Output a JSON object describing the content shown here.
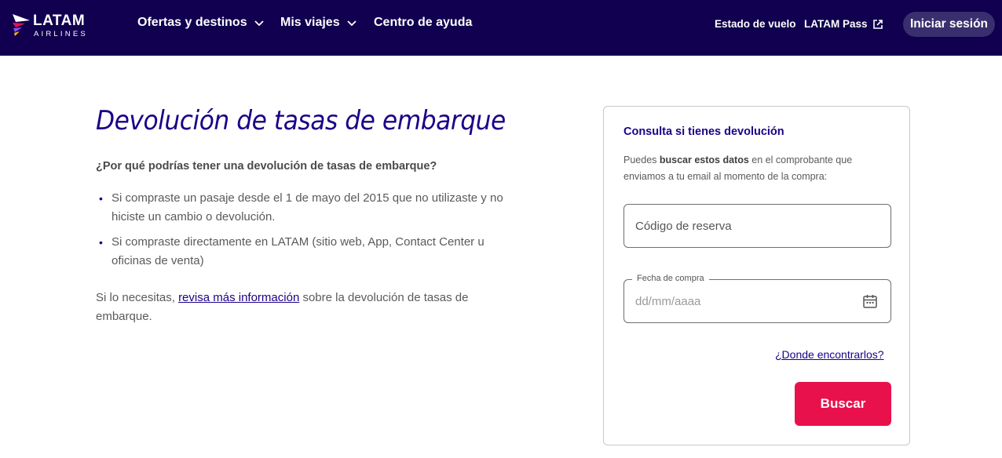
{
  "header": {
    "logo_word": "LATAM",
    "logo_sub": "AIRLINES",
    "nav": [
      {
        "label": "Ofertas y destinos"
      },
      {
        "label": "Mis viajes"
      },
      {
        "label": "Centro de ayuda"
      }
    ],
    "flight_status": "Estado de vuelo",
    "latam_pass": "LATAM Pass",
    "login": "Iniciar sesión"
  },
  "content": {
    "title": "Devolución de tasas de embarque",
    "question": "¿Por qué podrías tener una devolución de tasas de embarque?",
    "bullets": [
      "Si compraste un pasaje desde el 1 de mayo del 2015 que no utilizaste y no hiciste un cambio o devolución.",
      "Si compraste directamente en LATAM (sitio web, App, Contact Center u oficinas de venta)"
    ],
    "more_prefix": "Si lo necesitas, ",
    "more_link": "revisa más información",
    "more_suffix": " sobre la devolución de tasas de embarque."
  },
  "card": {
    "title": "Consulta si tienes devolución",
    "desc_prefix": "Puedes ",
    "desc_bold": "buscar estos datos",
    "desc_suffix": " en el comprobante que enviamos a tu email al momento de la compra:",
    "reservation_placeholder": "Código de reserva",
    "date_label": "Fecha de compra",
    "date_placeholder": "dd/mm/aaaa",
    "where_link": "¿Donde encontrarlos?",
    "search_button": "Buscar"
  },
  "colors": {
    "header_bg": "#10004f",
    "brand_blue": "#1b0088",
    "search_red": "#e8114b",
    "login_bg": "#3a2f6e"
  }
}
